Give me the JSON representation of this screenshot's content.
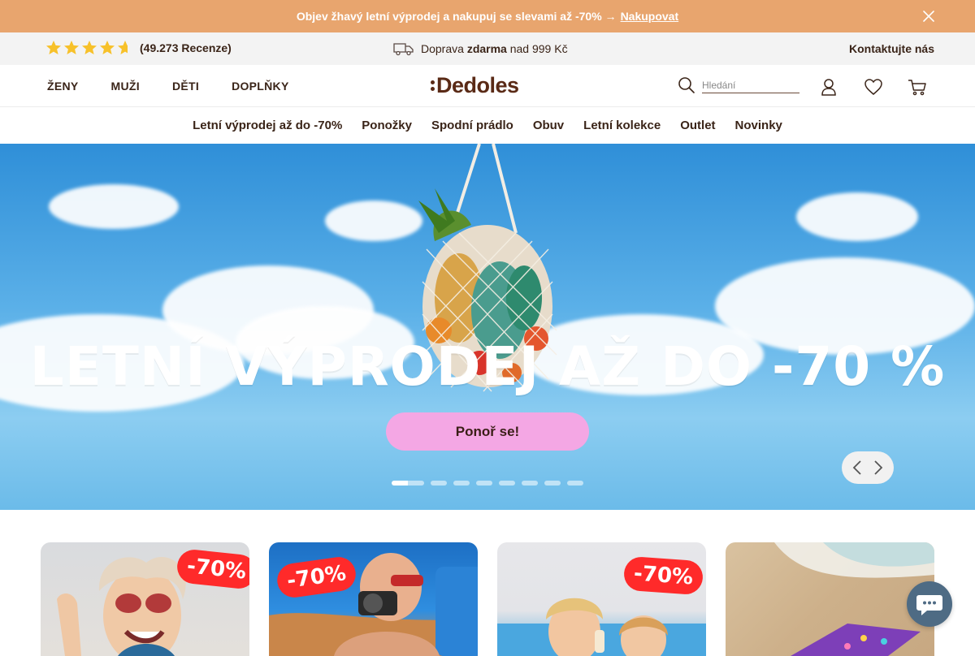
{
  "announcement": {
    "text": "Objev žhavý letní výprodej a nakupuj se slevami až -70% →",
    "link": "Nakupovat"
  },
  "infobar": {
    "rating_text": "(49.273 Recenze)",
    "shipping_prefix": "Doprava",
    "shipping_bold": "zdarma",
    "shipping_suffix": "nad 999 Kč",
    "contact": "Kontaktujte nás"
  },
  "header": {
    "categories": [
      "ŽENY",
      "MUŽI",
      "DĚTI",
      "DOPLŇKY"
    ],
    "logo": "Dedoles",
    "search_placeholder": "Hledání"
  },
  "subnav": {
    "items": [
      "Letní výprodej až do -70%",
      "Ponožky",
      "Spodní prádlo",
      "Obuv",
      "Letní kolekce",
      "Outlet",
      "Novinky"
    ]
  },
  "hero": {
    "title": "LETNÍ VÝPRODEJ AŽ DO -70 %",
    "cta": "Ponoř se!",
    "slide_count": 8,
    "active_slide": 1
  },
  "cards": [
    {
      "badge": "-70%"
    },
    {
      "badge": "-70%"
    },
    {
      "badge": "-70%"
    },
    {
      "badge": ""
    }
  ],
  "colors": {
    "announcement_bg": "#e8a56e",
    "cta_bg": "#f4a7e4",
    "badge_red": "#ff2a2a",
    "brand_brown": "#5a2a16"
  }
}
